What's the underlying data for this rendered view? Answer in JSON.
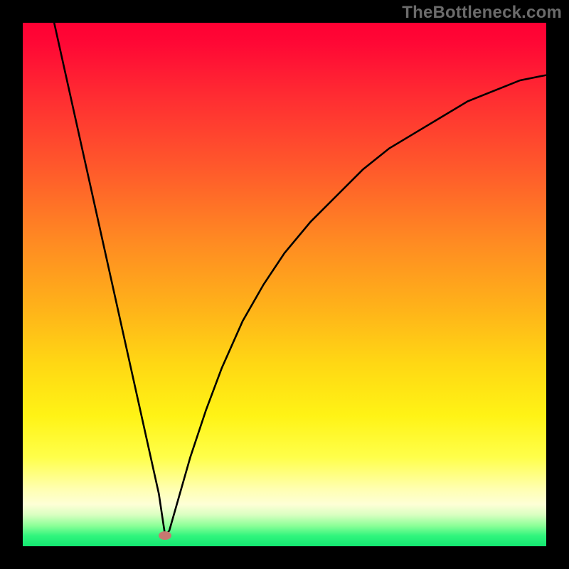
{
  "watermark": "TheBottleneck.com",
  "chart_data": {
    "type": "line",
    "title": "",
    "xlabel": "",
    "ylabel": "",
    "xlim": [
      0,
      100
    ],
    "ylim": [
      0,
      100
    ],
    "grid": false,
    "series": [
      {
        "name": "curve",
        "x": [
          6,
          8,
          10,
          12,
          14,
          16,
          18,
          20,
          22,
          24,
          26,
          27.2,
          28,
          30,
          32,
          35,
          38,
          42,
          46,
          50,
          55,
          60,
          65,
          70,
          75,
          80,
          85,
          90,
          95,
          100
        ],
        "y": [
          100,
          91,
          82,
          73,
          64,
          55,
          46,
          37,
          28,
          19,
          10,
          2,
          3,
          10,
          17,
          26,
          34,
          43,
          50,
          56,
          62,
          67,
          72,
          76,
          79,
          82,
          85,
          87,
          89,
          90
        ]
      }
    ],
    "marker": {
      "x": 27.2,
      "y": 2
    },
    "background_gradient": {
      "stops": [
        {
          "pos": 0,
          "color": "#ff0033"
        },
        {
          "pos": 50,
          "color": "#ffb419"
        },
        {
          "pos": 80,
          "color": "#ffff4a"
        },
        {
          "pos": 95,
          "color": "#8fff99"
        },
        {
          "pos": 100,
          "color": "#13e771"
        }
      ]
    }
  }
}
